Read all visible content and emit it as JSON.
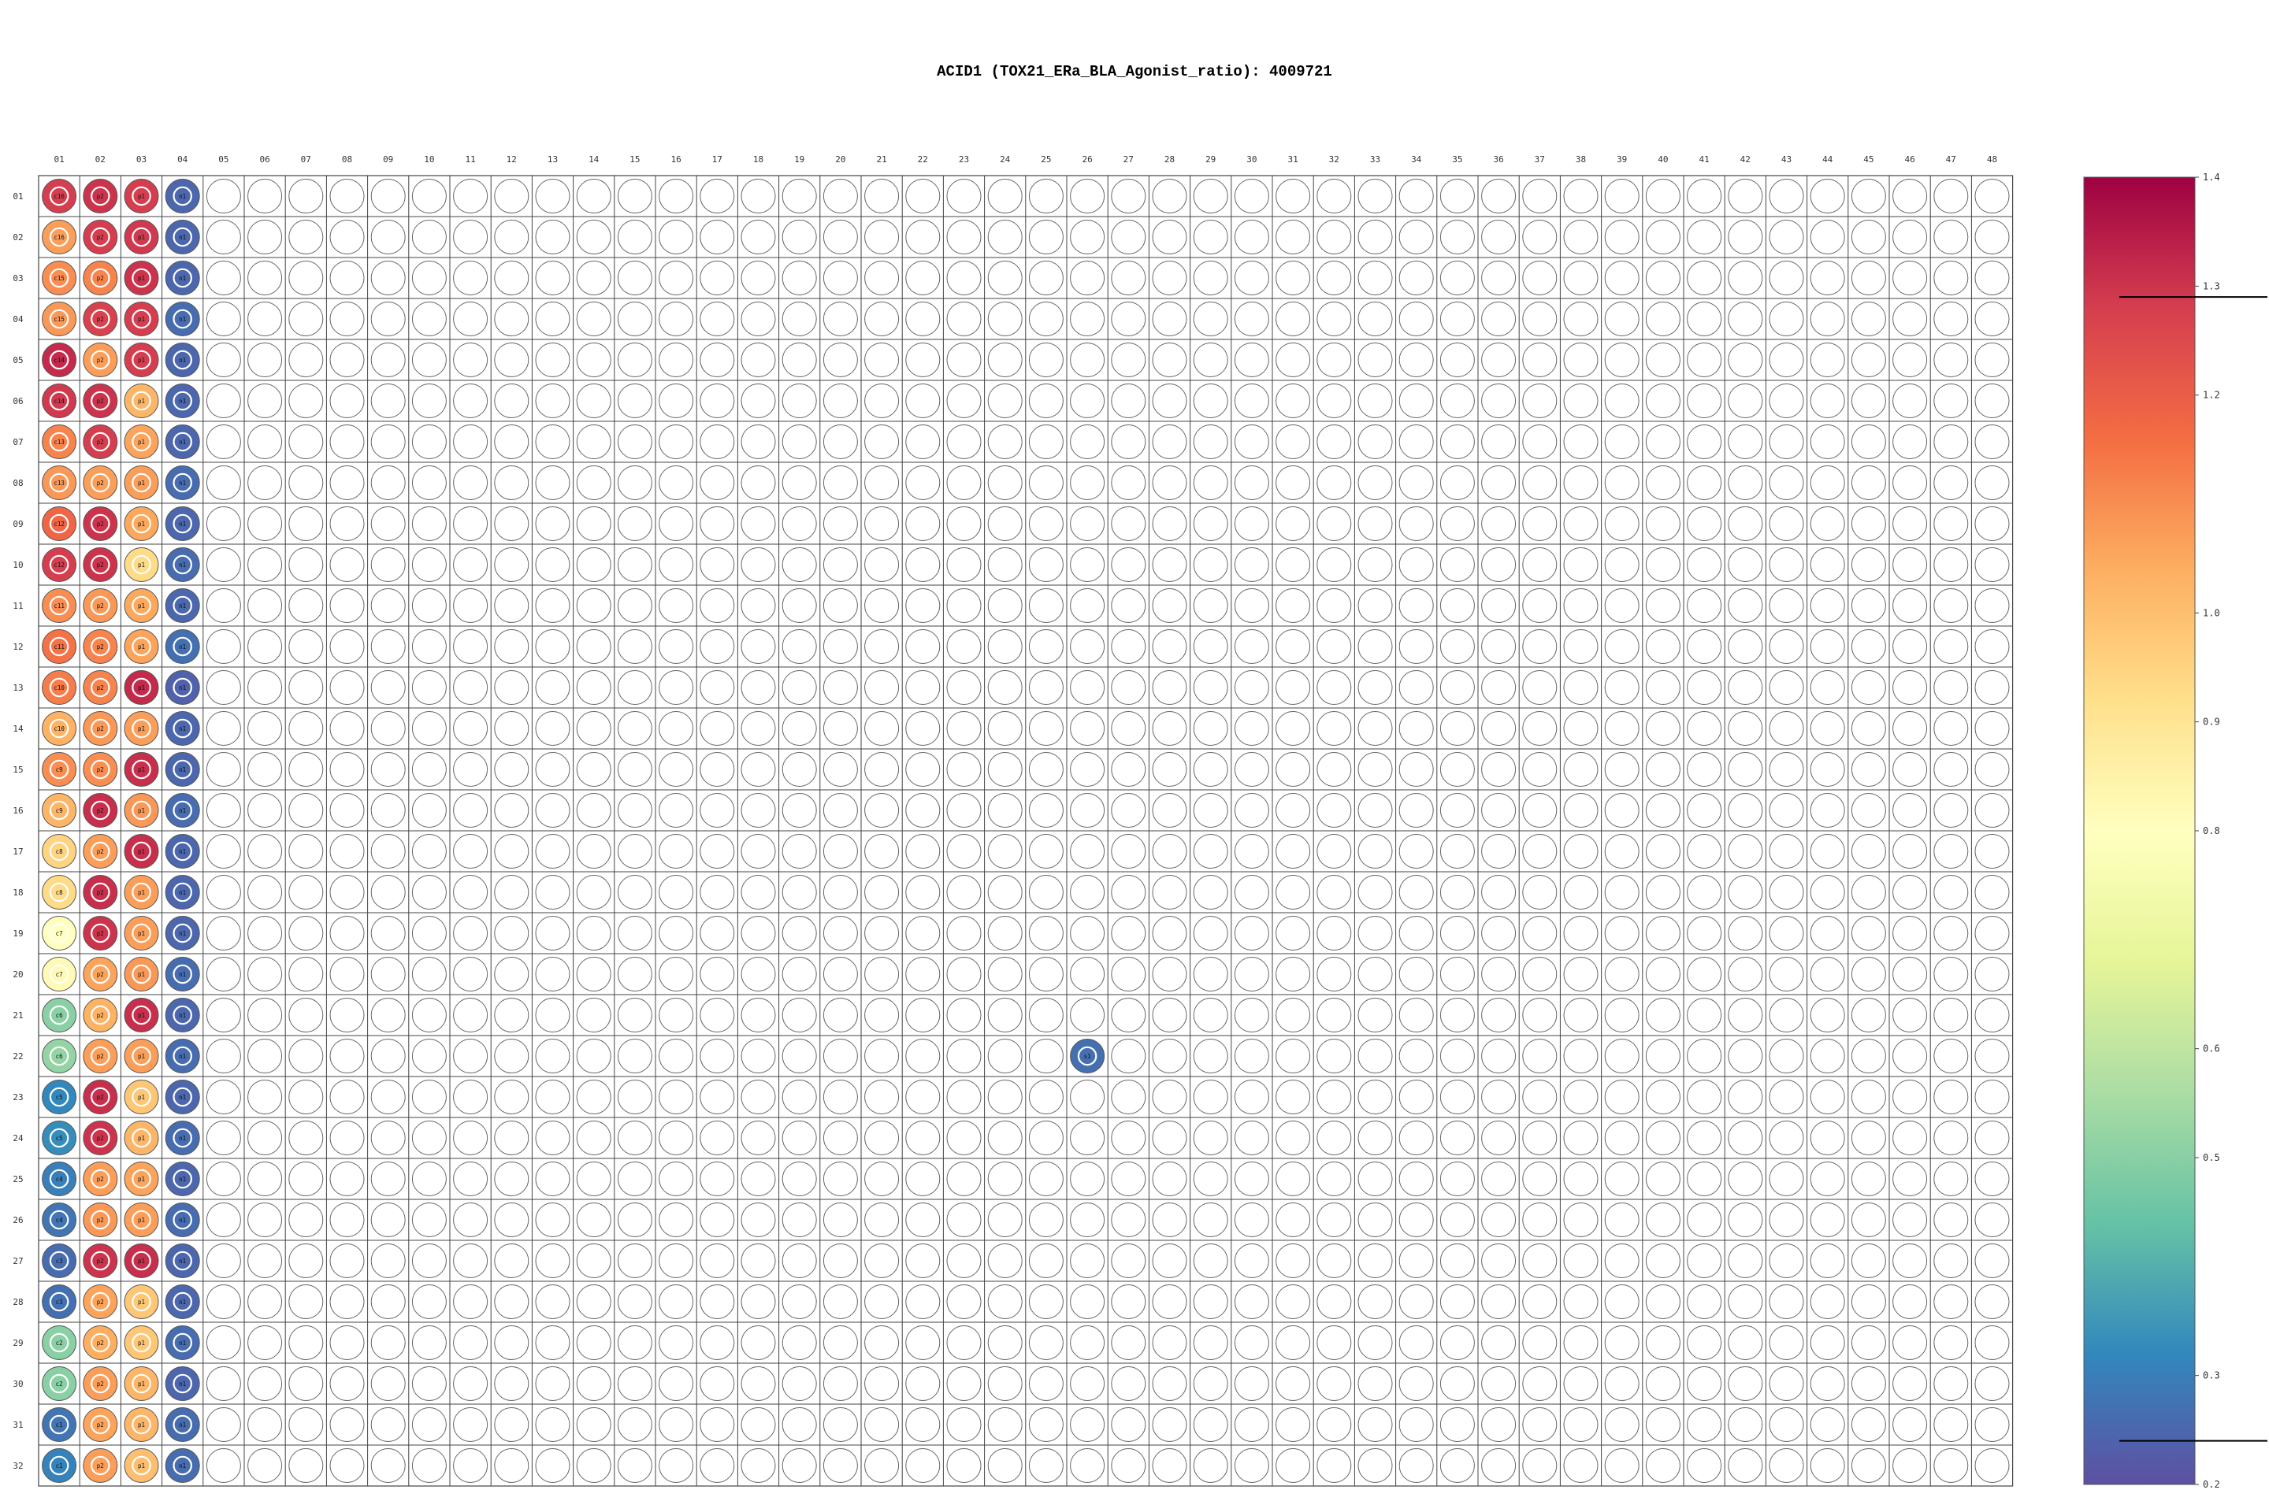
{
  "title": "ACID1 (TOX21_ERa_BLA_Agonist_ratio): 4009721",
  "chart_data": {
    "type": "heatmap",
    "title": "ACID1 (TOX21_ERa_BLA_Agonist_ratio): 4009721",
    "columns": [
      "01",
      "02",
      "03",
      "04",
      "05",
      "06",
      "07",
      "08",
      "09",
      "10",
      "11",
      "12",
      "13",
      "14",
      "15",
      "16",
      "17",
      "18",
      "19",
      "20",
      "21",
      "22",
      "23",
      "24",
      "25",
      "26",
      "27",
      "28",
      "29",
      "30",
      "31",
      "32",
      "33",
      "34",
      "35",
      "36",
      "37",
      "38",
      "39",
      "40",
      "41",
      "42",
      "43",
      "44",
      "45",
      "46",
      "47",
      "48"
    ],
    "rows": [
      "01",
      "02",
      "03",
      "04",
      "05",
      "06",
      "07",
      "08",
      "09",
      "10",
      "11",
      "12",
      "13",
      "14",
      "15",
      "16",
      "17",
      "18",
      "19",
      "20",
      "21",
      "22",
      "23",
      "24",
      "25",
      "26",
      "27",
      "28",
      "29",
      "30",
      "31",
      "32"
    ],
    "colorbar": {
      "min": 0.2,
      "max": 1.4,
      "ticks": [
        1.4,
        1.3,
        1.2,
        1.0,
        0.9,
        0.8,
        0.6,
        0.5,
        0.3,
        0.2
      ],
      "threshold_lines": [
        1.29,
        0.24
      ]
    },
    "wells": [
      {
        "row": "01",
        "col": "01",
        "label": "c16",
        "value": 1.28
      },
      {
        "row": "02",
        "col": "01",
        "label": "c16",
        "value": 1.07
      },
      {
        "row": "03",
        "col": "01",
        "label": "c15",
        "value": 1.1
      },
      {
        "row": "04",
        "col": "01",
        "label": "c15",
        "value": 1.08
      },
      {
        "row": "05",
        "col": "01",
        "label": "c14",
        "value": 1.32
      },
      {
        "row": "06",
        "col": "01",
        "label": "c14",
        "value": 1.29
      },
      {
        "row": "07",
        "col": "01",
        "label": "c13",
        "value": 1.12
      },
      {
        "row": "08",
        "col": "01",
        "label": "c13",
        "value": 1.08
      },
      {
        "row": "09",
        "col": "01",
        "label": "c12",
        "value": 1.18
      },
      {
        "row": "10",
        "col": "01",
        "label": "c12",
        "value": 1.28
      },
      {
        "row": "11",
        "col": "01",
        "label": "c11",
        "value": 1.1
      },
      {
        "row": "12",
        "col": "01",
        "label": "c11",
        "value": 1.15
      },
      {
        "row": "13",
        "col": "01",
        "label": "c10",
        "value": 1.13
      },
      {
        "row": "14",
        "col": "01",
        "label": "c10",
        "value": 1.03
      },
      {
        "row": "15",
        "col": "01",
        "label": "c9",
        "value": 1.1
      },
      {
        "row": "16",
        "col": "01",
        "label": "c9",
        "value": 1.02
      },
      {
        "row": "17",
        "col": "01",
        "label": "c8",
        "value": 0.95
      },
      {
        "row": "18",
        "col": "01",
        "label": "c8",
        "value": 0.93
      },
      {
        "row": "19",
        "col": "01",
        "label": "c7",
        "value": 0.8
      },
      {
        "row": "20",
        "col": "01",
        "label": "c7",
        "value": 0.82
      },
      {
        "row": "21",
        "col": "01",
        "label": "c6",
        "value": 0.5
      },
      {
        "row": "22",
        "col": "01",
        "label": "c6",
        "value": 0.52
      },
      {
        "row": "23",
        "col": "01",
        "label": "c5",
        "value": 0.32
      },
      {
        "row": "24",
        "col": "01",
        "label": "c5",
        "value": 0.33
      },
      {
        "row": "25",
        "col": "01",
        "label": "c4",
        "value": 0.3
      },
      {
        "row": "26",
        "col": "01",
        "label": "c4",
        "value": 0.28
      },
      {
        "row": "27",
        "col": "01",
        "label": "c3",
        "value": 0.26
      },
      {
        "row": "28",
        "col": "01",
        "label": "c3",
        "value": 0.27
      },
      {
        "row": "29",
        "col": "01",
        "label": "c2",
        "value": 0.5
      },
      {
        "row": "30",
        "col": "01",
        "label": "c2",
        "value": 0.5
      },
      {
        "row": "31",
        "col": "01",
        "label": "c1",
        "value": 0.28
      },
      {
        "row": "32",
        "col": "01",
        "label": "c1",
        "value": 0.31
      },
      {
        "row": "01",
        "col": "02",
        "label": "p2",
        "value": 1.3
      },
      {
        "row": "02",
        "col": "02",
        "label": "p2",
        "value": 1.28
      },
      {
        "row": "03",
        "col": "02",
        "label": "p2",
        "value": 1.12
      },
      {
        "row": "04",
        "col": "02",
        "label": "p2",
        "value": 1.27
      },
      {
        "row": "05",
        "col": "02",
        "label": "p2",
        "value": 1.07
      },
      {
        "row": "06",
        "col": "02",
        "label": "p2",
        "value": 1.3
      },
      {
        "row": "07",
        "col": "02",
        "label": "p2",
        "value": 1.28
      },
      {
        "row": "08",
        "col": "02",
        "label": "p2",
        "value": 1.07
      },
      {
        "row": "09",
        "col": "02",
        "label": "p2",
        "value": 1.3
      },
      {
        "row": "10",
        "col": "02",
        "label": "p2",
        "value": 1.3
      },
      {
        "row": "11",
        "col": "02",
        "label": "p2",
        "value": 1.08
      },
      {
        "row": "12",
        "col": "02",
        "label": "p2",
        "value": 1.12
      },
      {
        "row": "13",
        "col": "02",
        "label": "p2",
        "value": 1.12
      },
      {
        "row": "14",
        "col": "02",
        "label": "p2",
        "value": 1.08
      },
      {
        "row": "15",
        "col": "02",
        "label": "p2",
        "value": 1.1
      },
      {
        "row": "16",
        "col": "02",
        "label": "p2",
        "value": 1.31
      },
      {
        "row": "17",
        "col": "02",
        "label": "p2",
        "value": 1.07
      },
      {
        "row": "18",
        "col": "02",
        "label": "p2",
        "value": 1.31
      },
      {
        "row": "19",
        "col": "02",
        "label": "p2",
        "value": 1.3
      },
      {
        "row": "20",
        "col": "02",
        "label": "p2",
        "value": 1.06
      },
      {
        "row": "21",
        "col": "02",
        "label": "p2",
        "value": 1.03
      },
      {
        "row": "22",
        "col": "02",
        "label": "p2",
        "value": 1.07
      },
      {
        "row": "23",
        "col": "02",
        "label": "p2",
        "value": 1.31
      },
      {
        "row": "24",
        "col": "02",
        "label": "p2",
        "value": 1.3
      },
      {
        "row": "25",
        "col": "02",
        "label": "p2",
        "value": 1.07
      },
      {
        "row": "26",
        "col": "02",
        "label": "p2",
        "value": 1.08
      },
      {
        "row": "27",
        "col": "02",
        "label": "p2",
        "value": 1.3
      },
      {
        "row": "28",
        "col": "02",
        "label": "p2",
        "value": 1.06
      },
      {
        "row": "29",
        "col": "02",
        "label": "p2",
        "value": 1.04
      },
      {
        "row": "30",
        "col": "02",
        "label": "p2",
        "value": 1.07
      },
      {
        "row": "31",
        "col": "02",
        "label": "p2",
        "value": 1.06
      },
      {
        "row": "32",
        "col": "02",
        "label": "p2",
        "value": 1.07
      },
      {
        "row": "01",
        "col": "03",
        "label": "p1",
        "value": 1.28
      },
      {
        "row": "02",
        "col": "03",
        "label": "p1",
        "value": 1.29
      },
      {
        "row": "03",
        "col": "03",
        "label": "p1",
        "value": 1.3
      },
      {
        "row": "04",
        "col": "03",
        "label": "p1",
        "value": 1.28
      },
      {
        "row": "05",
        "col": "03",
        "label": "p1",
        "value": 1.28
      },
      {
        "row": "06",
        "col": "03",
        "label": "p1",
        "value": 1.02
      },
      {
        "row": "07",
        "col": "03",
        "label": "p1",
        "value": 1.06
      },
      {
        "row": "08",
        "col": "03",
        "label": "p1",
        "value": 1.07
      },
      {
        "row": "09",
        "col": "03",
        "label": "p1",
        "value": 1.05
      },
      {
        "row": "10",
        "col": "03",
        "label": "p1",
        "value": 0.93
      },
      {
        "row": "11",
        "col": "03",
        "label": "p1",
        "value": 1.05
      },
      {
        "row": "12",
        "col": "03",
        "label": "p1",
        "value": 1.06
      },
      {
        "row": "13",
        "col": "03",
        "label": "p1",
        "value": 1.32
      },
      {
        "row": "14",
        "col": "03",
        "label": "p1",
        "value": 1.07
      },
      {
        "row": "15",
        "col": "03",
        "label": "p1",
        "value": 1.31
      },
      {
        "row": "16",
        "col": "03",
        "label": "p1",
        "value": 1.08
      },
      {
        "row": "17",
        "col": "03",
        "label": "p1",
        "value": 1.31
      },
      {
        "row": "18",
        "col": "03",
        "label": "p1",
        "value": 1.07
      },
      {
        "row": "19",
        "col": "03",
        "label": "p1",
        "value": 1.07
      },
      {
        "row": "20",
        "col": "03",
        "label": "p1",
        "value": 1.08
      },
      {
        "row": "21",
        "col": "03",
        "label": "p1",
        "value": 1.31
      },
      {
        "row": "22",
        "col": "03",
        "label": "p1",
        "value": 1.07
      },
      {
        "row": "23",
        "col": "03",
        "label": "p1",
        "value": 0.98
      },
      {
        "row": "24",
        "col": "03",
        "label": "p1",
        "value": 1.02
      },
      {
        "row": "25",
        "col": "03",
        "label": "p1",
        "value": 1.06
      },
      {
        "row": "26",
        "col": "03",
        "label": "p1",
        "value": 1.07
      },
      {
        "row": "27",
        "col": "03",
        "label": "p1",
        "value": 1.31
      },
      {
        "row": "28",
        "col": "03",
        "label": "p1",
        "value": 0.98
      },
      {
        "row": "29",
        "col": "03",
        "label": "p1",
        "value": 0.98
      },
      {
        "row": "30",
        "col": "03",
        "label": "p1",
        "value": 1.02
      },
      {
        "row": "31",
        "col": "03",
        "label": "p1",
        "value": 1.02
      },
      {
        "row": "32",
        "col": "03",
        "label": "p1",
        "value": 1.0
      },
      {
        "row": "01",
        "col": "04",
        "label": "n1",
        "value": 0.25
      },
      {
        "row": "02",
        "col": "04",
        "label": "n1",
        "value": 0.25
      },
      {
        "row": "03",
        "col": "04",
        "label": "n1",
        "value": 0.25
      },
      {
        "row": "04",
        "col": "04",
        "label": "n1",
        "value": 0.26
      },
      {
        "row": "05",
        "col": "04",
        "label": "n1",
        "value": 0.25
      },
      {
        "row": "06",
        "col": "04",
        "label": "n1",
        "value": 0.25
      },
      {
        "row": "07",
        "col": "04",
        "label": "n1",
        "value": 0.25
      },
      {
        "row": "08",
        "col": "04",
        "label": "n1",
        "value": 0.26
      },
      {
        "row": "09",
        "col": "04",
        "label": "n1",
        "value": 0.25
      },
      {
        "row": "10",
        "col": "04",
        "label": "n1",
        "value": 0.26
      },
      {
        "row": "11",
        "col": "04",
        "label": "n1",
        "value": 0.25
      },
      {
        "row": "12",
        "col": "04",
        "label": "n1",
        "value": 0.27
      },
      {
        "row": "13",
        "col": "04",
        "label": "n1",
        "value": 0.24
      },
      {
        "row": "14",
        "col": "04",
        "label": "n1",
        "value": 0.25
      },
      {
        "row": "15",
        "col": "04",
        "label": "n1",
        "value": 0.25
      },
      {
        "row": "16",
        "col": "04",
        "label": "n1",
        "value": 0.26
      },
      {
        "row": "17",
        "col": "04",
        "label": "n1",
        "value": 0.25
      },
      {
        "row": "18",
        "col": "04",
        "label": "n1",
        "value": 0.25
      },
      {
        "row": "19",
        "col": "04",
        "label": "n1",
        "value": 0.25
      },
      {
        "row": "20",
        "col": "04",
        "label": "n1",
        "value": 0.26
      },
      {
        "row": "21",
        "col": "04",
        "label": "n1",
        "value": 0.25
      },
      {
        "row": "22",
        "col": "04",
        "label": "n1",
        "value": 0.26
      },
      {
        "row": "23",
        "col": "04",
        "label": "n1",
        "value": 0.25
      },
      {
        "row": "24",
        "col": "04",
        "label": "n1",
        "value": 0.26
      },
      {
        "row": "25",
        "col": "04",
        "label": "n1",
        "value": 0.25
      },
      {
        "row": "26",
        "col": "04",
        "label": "n1",
        "value": 0.26
      },
      {
        "row": "27",
        "col": "04",
        "label": "n1",
        "value": 0.25
      },
      {
        "row": "28",
        "col": "04",
        "label": "n1",
        "value": 0.25
      },
      {
        "row": "29",
        "col": "04",
        "label": "n1",
        "value": 0.26
      },
      {
        "row": "30",
        "col": "04",
        "label": "n1",
        "value": 0.25
      },
      {
        "row": "31",
        "col": "04",
        "label": "n1",
        "value": 0.26
      },
      {
        "row": "32",
        "col": "04",
        "label": "n1",
        "value": 0.26
      },
      {
        "row": "22",
        "col": "26",
        "label": "s1",
        "value": 0.27
      }
    ]
  }
}
